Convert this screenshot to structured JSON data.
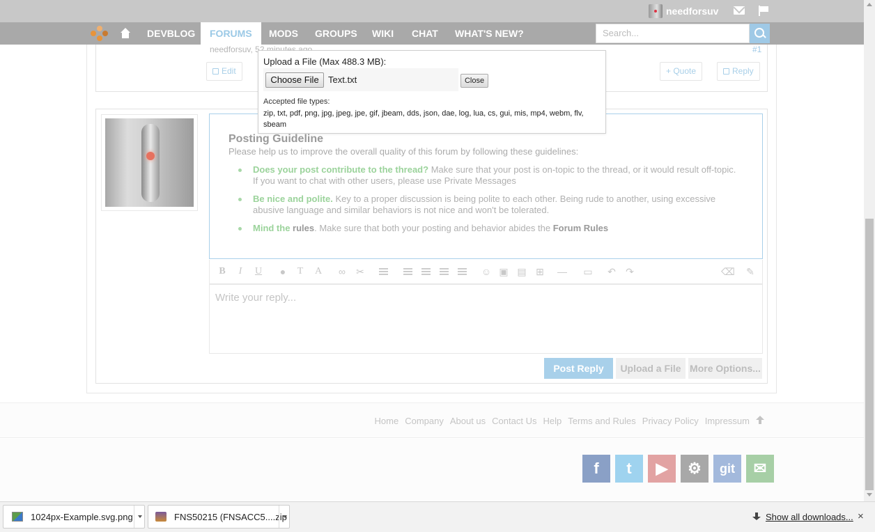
{
  "userbar": {
    "username": "needforsuv"
  },
  "nav": {
    "items": [
      "DEVBLOG",
      "FORUMS",
      "MODS",
      "GROUPS",
      "WIKI",
      "CHAT",
      "WHAT'S NEW?"
    ],
    "search_placeholder": "Search..."
  },
  "post": {
    "meta": "needforsuv, 52 minutes ago",
    "number": "#1",
    "edit_label": "Edit",
    "quote_label": "+ Quote",
    "reply_label": "Reply"
  },
  "guideline": {
    "title": "Posting Guideline",
    "intro": "Please help us to improve the overall quality of this forum by following these guidelines:",
    "items": [
      {
        "strong": "Does your post contribute to the thread?",
        "text": " Make sure that your post is on-topic to the thread, or it would result off-topic. If you want to chat with other users, please use Private Messages"
      },
      {
        "strong": "Be nice and polite.",
        "text": " Key to a proper discussion is being polite to each other. Being rude to another, using excessive abusive language and similar behaviors is not nice and won't be tolerated."
      },
      {
        "strong": "Mind the",
        "strong2": " rules",
        "text": ". Make sure that both your posting and behavior abides the ",
        "link": "Forum Rules"
      }
    ]
  },
  "editor": {
    "placeholder": "Write your reply..."
  },
  "buttons": {
    "post_reply": "Post Reply",
    "upload_file": "Upload a File",
    "more_options": "More Options..."
  },
  "footer": {
    "links": [
      "Home",
      "Company",
      "About us",
      "Contact Us",
      "Help",
      "Terms and Rules",
      "Privacy Policy",
      "Impressum"
    ]
  },
  "social": [
    {
      "name": "facebook",
      "glyph": "f",
      "color": "#8aa0c6"
    },
    {
      "name": "twitter",
      "glyph": "t",
      "color": "#9fd3ef"
    },
    {
      "name": "youtube",
      "glyph": "▶",
      "color": "#e2a3a3"
    },
    {
      "name": "steam",
      "glyph": "⚙",
      "color": "#a8a8a8"
    },
    {
      "name": "git",
      "glyph": "git",
      "color": "#a3b9dc"
    },
    {
      "name": "email",
      "glyph": "✉",
      "color": "#a7cfa6"
    }
  ],
  "upload_popup": {
    "title": "Upload a File (Max 488.3 MB):",
    "choose_label": "Choose File",
    "file_name": "Text.txt",
    "close_label": "Close",
    "accepted_label": "Accepted file types:",
    "accepted_types": "zip, txt, pdf, png, jpg, jpeg, jpe, gif, jbeam, dds, json, dae, log, lua, cs, gui, mis, mp4, webm, flv, sbeam"
  },
  "downloads": {
    "items": [
      "1024px-Example.svg.png",
      "FNS50215 (FNSACC5....zip"
    ],
    "show_all": "Show all downloads...",
    "close": "×"
  }
}
